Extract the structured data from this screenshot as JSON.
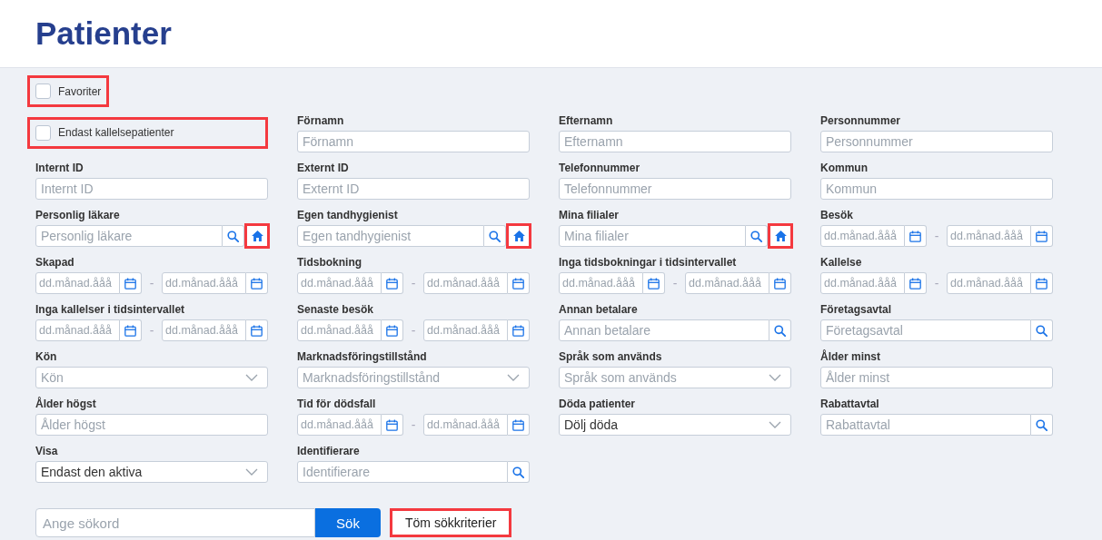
{
  "title": "Patienter",
  "favorites": {
    "label": "Favoriter",
    "checked": false,
    "highlighted": true
  },
  "fields": [
    {
      "kind": "checkbox",
      "label": "Endast kallelsepatienter",
      "checked": false,
      "highlighted": true
    },
    {
      "kind": "text",
      "label": "Förnamn",
      "placeholder": "Förnamn"
    },
    {
      "kind": "text",
      "label": "Efternamn",
      "placeholder": "Efternamn"
    },
    {
      "kind": "text",
      "label": "Personnummer",
      "placeholder": "Personnummer"
    },
    {
      "kind": "text",
      "label": "Internt ID",
      "placeholder": "Internt ID"
    },
    {
      "kind": "text",
      "label": "Externt ID",
      "placeholder": "Externt ID"
    },
    {
      "kind": "text",
      "label": "Telefonnummer",
      "placeholder": "Telefonnummer"
    },
    {
      "kind": "text",
      "label": "Kommun",
      "placeholder": "Kommun"
    },
    {
      "kind": "search_home",
      "label": "Personlig läkare",
      "placeholder": "Personlig läkare",
      "home_highlighted": true
    },
    {
      "kind": "search_home",
      "label": "Egen tandhygienist",
      "placeholder": "Egen tandhygienist",
      "home_highlighted": true
    },
    {
      "kind": "search_home",
      "label": "Mina filialer",
      "placeholder": "Mina filialer",
      "home_highlighted": true
    },
    {
      "kind": "date_range",
      "label": "Besök",
      "from_placeholder": "dd.månad.ååå",
      "separator": "-",
      "to_placeholder": "dd.månad.ååå"
    },
    {
      "kind": "date_range",
      "label": "Skapad",
      "from_placeholder": "dd.månad.ååå",
      "separator": "-",
      "to_placeholder": "dd.månad.ååå"
    },
    {
      "kind": "date_range",
      "label": "Tidsbokning",
      "from_placeholder": "dd.månad.ååå",
      "separator": "-",
      "to_placeholder": "dd.månad.ååå"
    },
    {
      "kind": "date_range",
      "label": "Inga tidsbokningar i tidsintervallet",
      "from_placeholder": "dd.månad.ååå",
      "separator": "-",
      "to_placeholder": "dd.månad.ååå"
    },
    {
      "kind": "date_range",
      "label": "Kallelse",
      "from_placeholder": "dd.månad.ååå",
      "separator": "-",
      "to_placeholder": "dd.månad.ååå"
    },
    {
      "kind": "date_range",
      "label": "Inga kallelser i tidsintervallet",
      "from_placeholder": "dd.månad.ååå",
      "separator": "-",
      "to_placeholder": "dd.månad.ååå"
    },
    {
      "kind": "date_range",
      "label": "Senaste besök",
      "from_placeholder": "dd.månad.ååå",
      "separator": "-",
      "to_placeholder": "dd.månad.ååå"
    },
    {
      "kind": "search",
      "label": "Annan betalare",
      "placeholder": "Annan betalare"
    },
    {
      "kind": "search",
      "label": "Företagsavtal",
      "placeholder": "Företagsavtal"
    },
    {
      "kind": "select",
      "label": "Kön",
      "placeholder": "Kön"
    },
    {
      "kind": "select",
      "label": "Marknadsföringstillstånd",
      "placeholder": "Marknadsföringstillstånd"
    },
    {
      "kind": "select",
      "label": "Språk som används",
      "placeholder": "Språk som används"
    },
    {
      "kind": "text",
      "label": "Ålder minst",
      "placeholder": "Ålder minst"
    },
    {
      "kind": "text",
      "label": "Ålder högst",
      "placeholder": "Ålder högst"
    },
    {
      "kind": "date_range",
      "label": "Tid för dödsfall",
      "from_placeholder": "dd.månad.ååå",
      "separator": "-",
      "to_placeholder": "dd.månad.ååå"
    },
    {
      "kind": "select",
      "label": "Döda patienter",
      "value": "Dölj döda"
    },
    {
      "kind": "search",
      "label": "Rabattavtal",
      "placeholder": "Rabattavtal"
    },
    {
      "kind": "select",
      "label": "Visa",
      "value": "Endast den aktiva"
    },
    {
      "kind": "search",
      "label": "Identifierare",
      "placeholder": "Identifierare"
    }
  ],
  "search": {
    "placeholder": "Ange sökord",
    "button": "Sök"
  },
  "clear_button": {
    "label": "Töm sökkriterier",
    "highlighted": true
  }
}
